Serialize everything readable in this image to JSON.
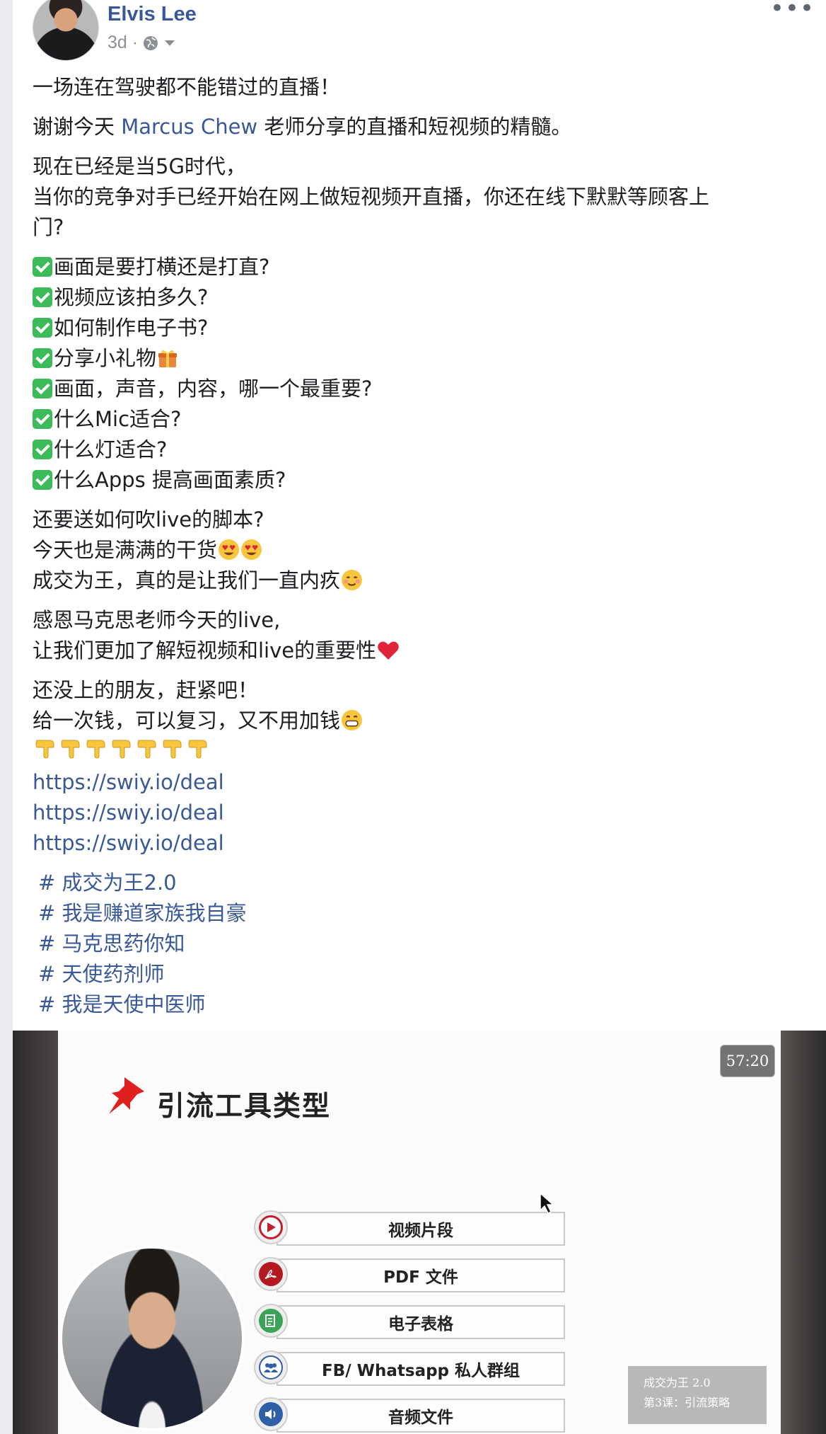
{
  "post": {
    "author": "Elvis Lee",
    "time": "3d ·",
    "more": "•••"
  },
  "body": {
    "p1": "一场连在驾驶都不能错过的直播！",
    "p2_before": "谢谢今天 ",
    "p2_link": "Marcus Chew",
    "p2_after": " 老师分享的直播和短视频的精髓。",
    "p3_l1": "现在已经是当5G时代，",
    "p3_l2": "当你的竞争对手已经开始在网上做短视频开直播，你还在线下默默等顾客上",
    "p3_l3": "门?",
    "checklist": [
      "画面是要打横还是打直?",
      "视频应该拍多久?",
      "如何制作电子书?",
      "分享小礼物",
      "画面，声音，内容，哪一个最重要?",
      "什么Mic适合?",
      "什么灯适合?",
      "什么Apps 提高画面素质?"
    ],
    "p5_l1": "还要送如何吹live的脚本?",
    "p5_l2": "今天也是满满的干货",
    "p5_l3": "成交为王，真的是让我们一直内疚",
    "p6_l1": "感恩马克思老师今天的live,",
    "p6_l2": "让我们更加了解短视频和live的重要性",
    "p7_l1": "还没上的朋友，赶紧吧！",
    "p7_l2": "给一次钱，可以复习，又不用加钱",
    "links": [
      "https://swiy.io/deal",
      "https://swiy.io/deal",
      "https://swiy.io/deal"
    ],
    "hashtags": [
      "# 成交为王2.0",
      "# 我是赚道家族我自豪",
      "# 马克思药你知",
      "# 天使药剂师",
      "# 我是天使中医师"
    ]
  },
  "video": {
    "timer": "57:20",
    "slide_title": "引流工具类型",
    "items": [
      "视频片段",
      "PDF 文件",
      "电子表格",
      "FB/ Whatsapp 私人群组",
      "音频文件"
    ],
    "caption_l1": "成交为王 2.0",
    "caption_l2": "第3课：引流策略"
  },
  "colors": {
    "link": "#385898",
    "check": "#3dbb5a",
    "pin": "#e0201e"
  }
}
